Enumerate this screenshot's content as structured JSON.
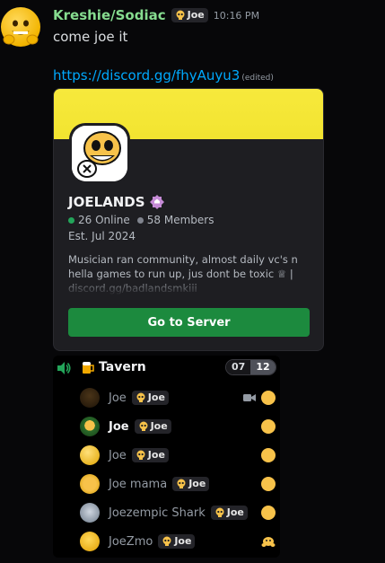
{
  "message": {
    "author": "Kreshie/Sodiac",
    "author_tag": "Joe",
    "timestamp": "10:16 PM",
    "text": "come joe it",
    "link": "https://discord.gg/fhyAuyu3",
    "edited": "(edited)"
  },
  "invite_card": {
    "banner_color": "#f5e73a",
    "server_name": "JOELANDS",
    "online": "26 Online",
    "members": "58 Members",
    "established": "Est. Jul 2024",
    "description": [
      "Musician ran community, almost daily vc's n",
      "hella games to run up, jus dont be toxic ♕ |",
      "discord.gg/badlandsmkiii"
    ],
    "button_label": "Go to Server",
    "button_color": "#1c8a3e"
  },
  "voice_channel": {
    "name": "Tavern",
    "count_current": "07",
    "count_max": "12",
    "members": [
      {
        "name": "Joe",
        "tag": "Joe",
        "active": false,
        "camera": true,
        "indicator": "status"
      },
      {
        "name": "Joe",
        "tag": "Joe",
        "active": true,
        "camera": false,
        "indicator": "status"
      },
      {
        "name": "Joe",
        "tag": "Joe",
        "active": false,
        "camera": false,
        "indicator": "status"
      },
      {
        "name": "Joe mama",
        "tag": "Joe",
        "active": false,
        "camera": false,
        "indicator": "status"
      },
      {
        "name": "Joezempic Shark",
        "tag": "Joe",
        "active": false,
        "camera": false,
        "indicator": "status"
      },
      {
        "name": "JoeZmo",
        "tag": "Joe",
        "active": false,
        "camera": false,
        "indicator": "emoji"
      }
    ]
  },
  "colors": {
    "author": "#86dc8f",
    "link": "#00a8fc",
    "online_dot": "#23a55a",
    "members_dot": "#80848e",
    "status": "#f7c24a"
  }
}
